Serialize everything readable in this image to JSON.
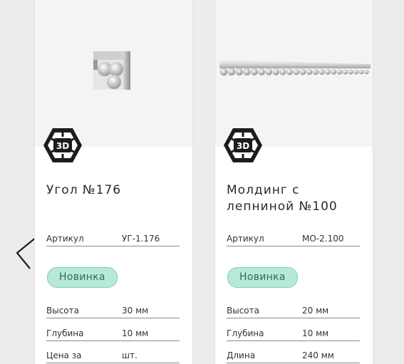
{
  "products": [
    {
      "name": "Угол №176",
      "badge_3d": "3D",
      "article_label": "Артикул",
      "article_value": "УГ-1.176",
      "tag": "Новинка",
      "specs": [
        {
          "label": "Высота",
          "value": "30 мм"
        },
        {
          "label": "Глубина",
          "value": "10 мм"
        },
        {
          "label": "Цена за",
          "value": "шт."
        }
      ]
    },
    {
      "name": "Молдинг с лепниной №100",
      "badge_3d": "3D",
      "article_label": "Артикул",
      "article_value": "МО-2.100",
      "tag": "Новинка",
      "specs": [
        {
          "label": "Высота",
          "value": "20 мм"
        },
        {
          "label": "Глубина",
          "value": "10 мм"
        },
        {
          "label": "Длина",
          "value": "240 мм"
        }
      ]
    }
  ],
  "nav": {
    "prev_icon": "chevron-left-icon"
  },
  "colors": {
    "tag_bg": "#b7ead6",
    "tag_border": "#7fcfb1",
    "tag_text": "#2f6b55",
    "page_bg": "#ececea"
  }
}
